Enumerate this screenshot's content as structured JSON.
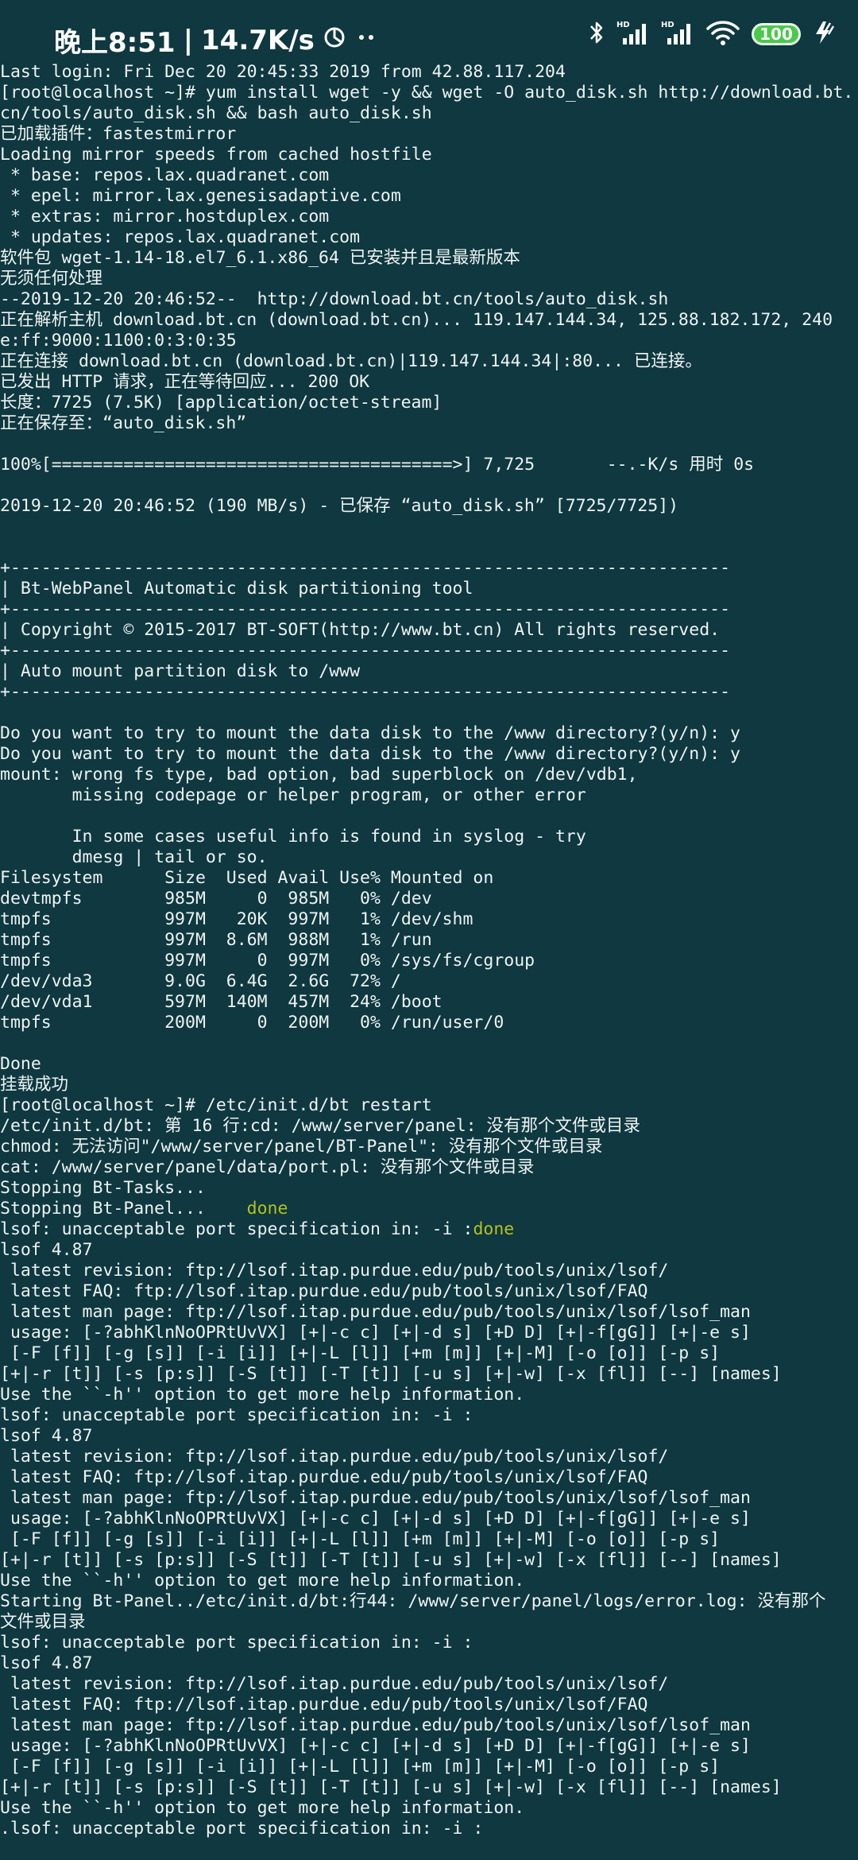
{
  "status_bar": {
    "time": "晚上8:51",
    "net_speed": "14.7K/s",
    "battery": "100",
    "icons": [
      "hotspot-icon",
      "more-icon",
      "bluetooth-icon",
      "signal-hd-1-icon",
      "signal-hd-2-icon",
      "wifi-icon",
      "battery-icon",
      "charging-icon"
    ]
  },
  "terminal": {
    "lines": [
      "Last login: Fri Dec 20 20:45:33 2019 from 42.88.117.204",
      "[root@localhost ~]# yum install wget -y && wget -O auto_disk.sh http://download.bt.",
      "cn/tools/auto_disk.sh && bash auto_disk.sh",
      "已加载插件：fastestmirror",
      "Loading mirror speeds from cached hostfile",
      " * base: repos.lax.quadranet.com",
      " * epel: mirror.lax.genesisadaptive.com",
      " * extras: mirror.hostduplex.com",
      " * updates: repos.lax.quadranet.com",
      "软件包 wget-1.14-18.el7_6.1.x86_64 已安装并且是最新版本",
      "无须任何处理",
      "--2019-12-20 20:46:52--  http://download.bt.cn/tools/auto_disk.sh",
      "正在解析主机 download.bt.cn (download.bt.cn)... 119.147.144.34, 125.88.182.172, 240",
      "e:ff:9000:1100:0:3:0:35",
      "正在连接 download.bt.cn (download.bt.cn)|119.147.144.34|:80... 已连接。",
      "已发出 HTTP 请求，正在等待回应... 200 OK",
      "长度：7725 (7.5K) [application/octet-stream]",
      "正在保存至：“auto_disk.sh”",
      "",
      "100%[=======================================>] 7,725       --.-K/s 用时 0s",
      "",
      "2019-12-20 20:46:52 (190 MB/s) - 已保存 “auto_disk.sh” [7725/7725])",
      "",
      "",
      "+----------------------------------------------------------------------",
      "| Bt-WebPanel Automatic disk partitioning tool",
      "+----------------------------------------------------------------------",
      "| Copyright © 2015-2017 BT-SOFT(http://www.bt.cn) All rights reserved.",
      "+----------------------------------------------------------------------",
      "| Auto mount partition disk to /www",
      "+----------------------------------------------------------------------",
      "",
      "Do you want to try to mount the data disk to the /www directory?(y/n): y",
      "Do you want to try to mount the data disk to the /www directory?(y/n): y",
      "mount: wrong fs type, bad option, bad superblock on /dev/vdb1,",
      "       missing codepage or helper program, or other error",
      "",
      "       In some cases useful info is found in syslog - try",
      "       dmesg | tail or so.",
      "Filesystem      Size  Used Avail Use% Mounted on",
      "devtmpfs        985M     0  985M   0% /dev",
      "tmpfs           997M   20K  997M   1% /dev/shm",
      "tmpfs           997M  8.6M  988M   1% /run",
      "tmpfs           997M     0  997M   0% /sys/fs/cgroup",
      "/dev/vda3       9.0G  6.4G  2.6G  72% /",
      "/dev/vda1       597M  140M  457M  24% /boot",
      "tmpfs           200M     0  200M   0% /run/user/0",
      "",
      "Done",
      "挂载成功",
      "[root@localhost ~]# /etc/init.d/bt restart",
      "/etc/init.d/bt: 第 16 行:cd: /www/server/panel: 没有那个文件或目录",
      "chmod: 无法访问\"/www/server/panel/BT-Panel\": 没有那个文件或目录",
      "cat: /www/server/panel/data/port.pl: 没有那个文件或目录",
      "Stopping Bt-Tasks...    ",
      "Stopping Bt-Panel...    ",
      "lsof: unacceptable port specification in: -i :",
      "lsof 4.87",
      " latest revision: ftp://lsof.itap.purdue.edu/pub/tools/unix/lsof/",
      " latest FAQ: ftp://lsof.itap.purdue.edu/pub/tools/unix/lsof/FAQ",
      " latest man page: ftp://lsof.itap.purdue.edu/pub/tools/unix/lsof/lsof_man",
      " usage: [-?abhKlnNoOPRtUvVX] [+|-c c] [+|-d s] [+D D] [+|-f[gG]] [+|-e s]",
      " [-F [f]] [-g [s]] [-i [i]] [+|-L [l]] [+m [m]] [+|-M] [-o [o]] [-p s]",
      "[+|-r [t]] [-s [p:s]] [-S [t]] [-T [t]] [-u s] [+|-w] [-x [fl]] [--] [names]",
      "Use the ``-h'' option to get more help information.",
      "lsof: unacceptable port specification in: -i :",
      "lsof 4.87",
      " latest revision: ftp://lsof.itap.purdue.edu/pub/tools/unix/lsof/",
      " latest FAQ: ftp://lsof.itap.purdue.edu/pub/tools/unix/lsof/FAQ",
      " latest man page: ftp://lsof.itap.purdue.edu/pub/tools/unix/lsof/lsof_man",
      " usage: [-?abhKlnNoOPRtUvVX] [+|-c c] [+|-d s] [+D D] [+|-f[gG]] [+|-e s]",
      " [-F [f]] [-g [s]] [-i [i]] [+|-L [l]] [+m [m]] [+|-M] [-o [o]] [-p s]",
      "[+|-r [t]] [-s [p:s]] [-S [t]] [-T [t]] [-u s] [+|-w] [-x [fl]] [--] [names]",
      "Use the ``-h'' option to get more help information.",
      "Starting Bt-Panel../etc/init.d/bt:行44: /www/server/panel/logs/error.log: 没有那个",
      "文件或目录",
      "lsof: unacceptable port specification in: -i :",
      "lsof 4.87",
      " latest revision: ftp://lsof.itap.purdue.edu/pub/tools/unix/lsof/",
      " latest FAQ: ftp://lsof.itap.purdue.edu/pub/tools/unix/lsof/FAQ",
      " latest man page: ftp://lsof.itap.purdue.edu/pub/tools/unix/lsof/lsof_man",
      " usage: [-?abhKlnNoOPRtUvVX] [+|-c c] [+|-d s] [+D D] [+|-f[gG]] [+|-e s]",
      " [-F [f]] [-g [s]] [-i [i]] [+|-L [l]] [+m [m]] [+|-M] [-o [o]] [-p s]",
      "[+|-r [t]] [-s [p:s]] [-S [t]] [-T [t]] [-u s] [+|-w] [-x [fl]] [--] [names]",
      "Use the ``-h'' option to get more help information.",
      ".lsof: unacceptable port specification in: -i :"
    ],
    "status_words": {
      "55": "done",
      "56": "done"
    },
    "colors": {
      "background": "#0f3840",
      "text": "#eef3f3",
      "ok": "#b4c21b"
    }
  }
}
